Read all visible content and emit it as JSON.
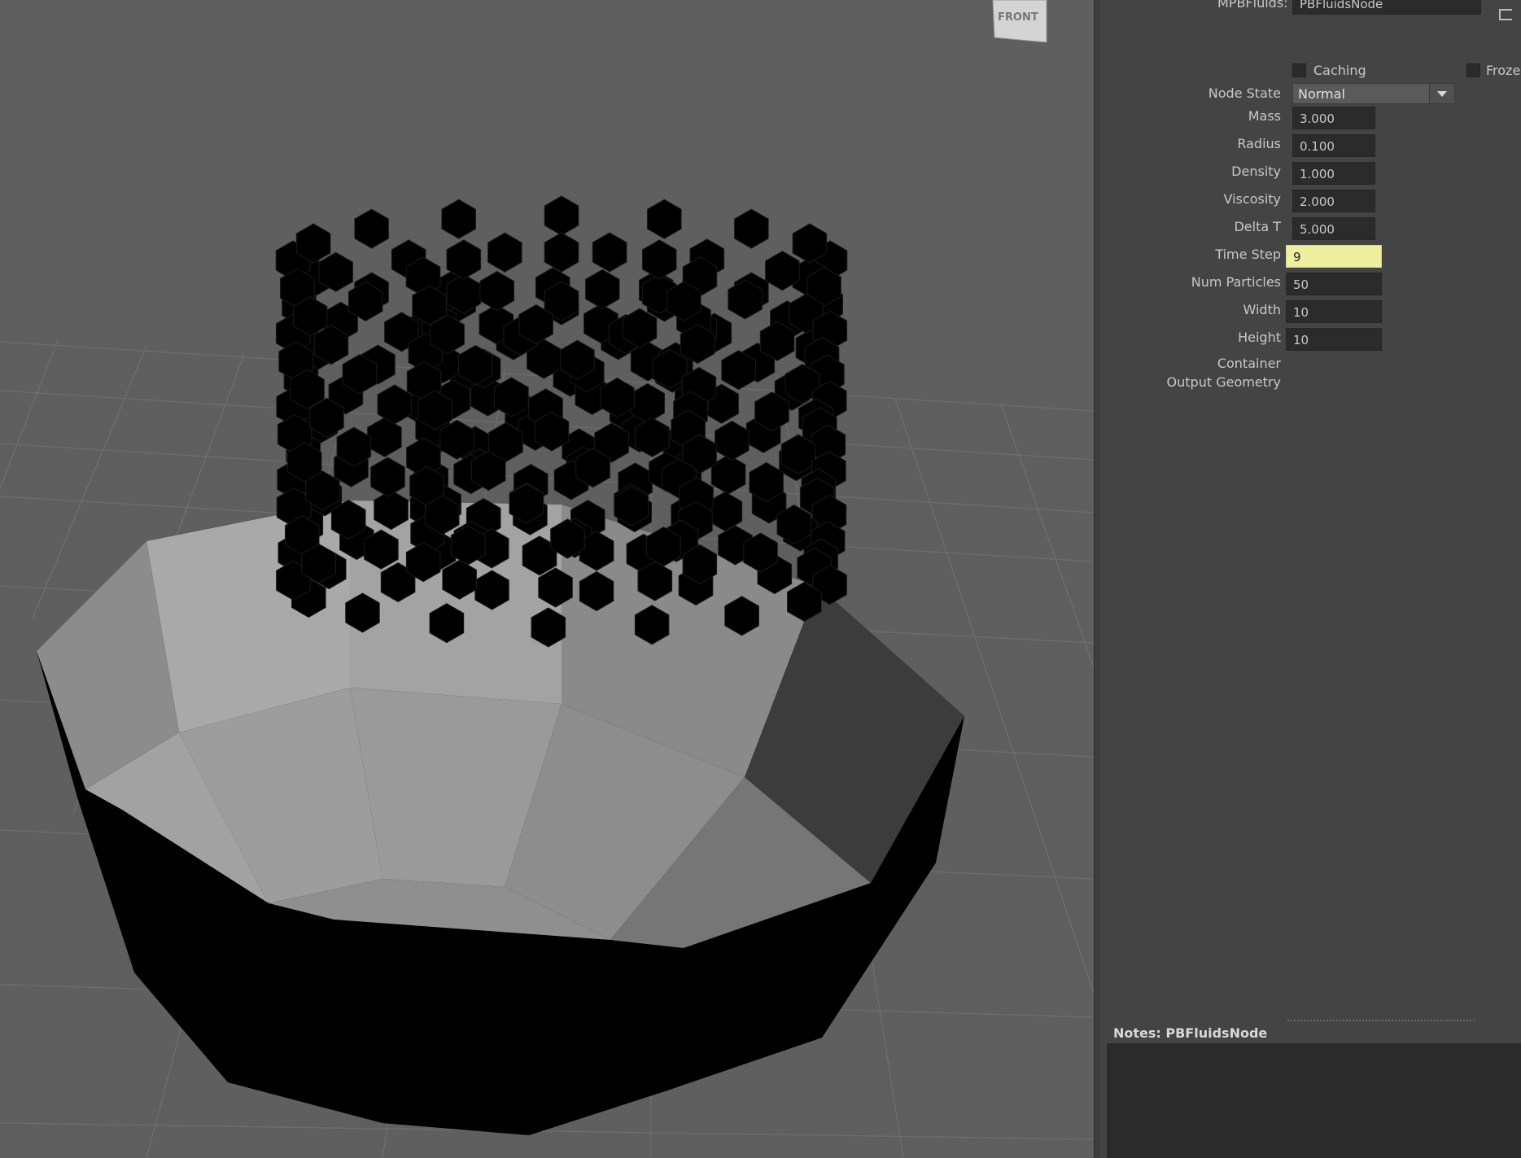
{
  "viewport": {
    "view_cube_label": "FRONT"
  },
  "attributes": {
    "node_type_label": "MPBFluids:",
    "node_name": "PBFluidsNode",
    "caching_label": "Caching",
    "frozen_label": "Frozen",
    "node_state_label": "Node State",
    "node_state_value": "Normal",
    "fields": [
      {
        "label": "Mass",
        "value": "3.000"
      },
      {
        "label": "Radius",
        "value": "0.100"
      },
      {
        "label": "Density",
        "value": "1.000"
      },
      {
        "label": "Viscosity",
        "value": "2.000"
      },
      {
        "label": "Delta T",
        "value": "5.000"
      },
      {
        "label": "Time Step",
        "value": "9"
      },
      {
        "label": "Num Particles",
        "value": "50"
      },
      {
        "label": "Width",
        "value": "10"
      },
      {
        "label": "Height",
        "value": "10"
      }
    ],
    "container_label": "Container",
    "output_geometry_label": "Output Geometry"
  },
  "notes": {
    "label": "Notes:  PBFluidsNode"
  },
  "colors": {
    "viewport_bg": "#5f5f5f",
    "panel_bg": "#444444",
    "field_bg": "#2b2b2b",
    "highlight_field": "#efefa1"
  }
}
